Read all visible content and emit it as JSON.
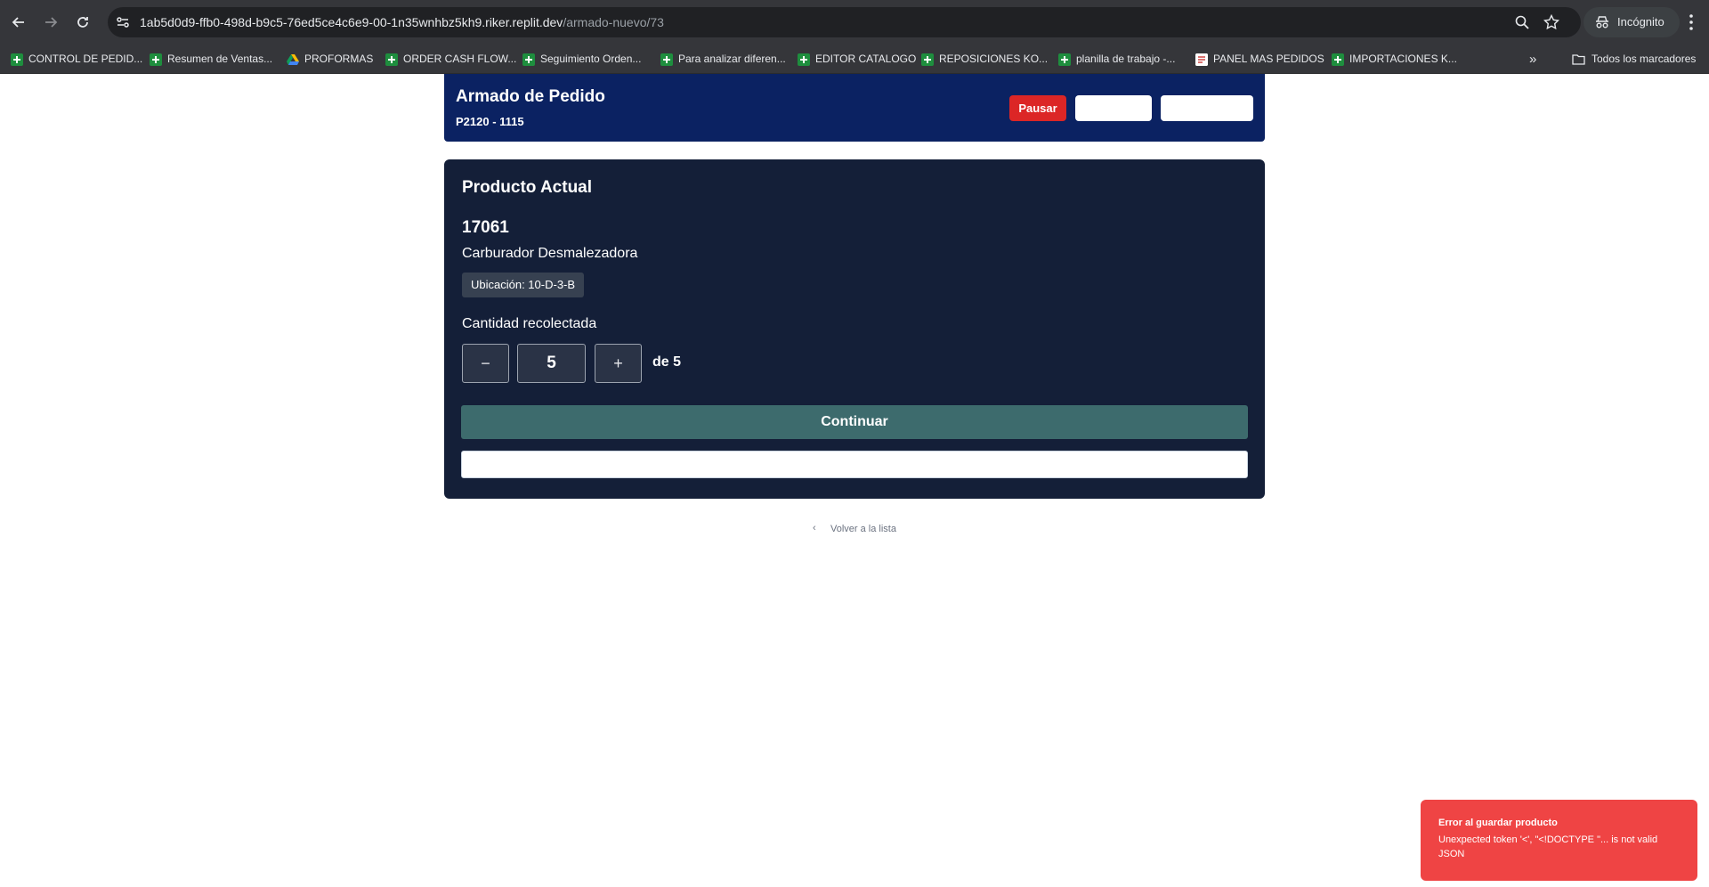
{
  "browser": {
    "url_host": "1ab5d0d9-ffb0-498d-b9c5-76ed5ce4c6e9-00-1n35wnhbz5kh9.riker.replit.dev",
    "url_path": "/armado-nuevo/73",
    "incognito_label": "Incógnito",
    "bookmarks": [
      {
        "label": "CONTROL DE PEDID...",
        "icon": "sheets-icon"
      },
      {
        "label": "Resumen de Ventas...",
        "icon": "sheets-icon"
      },
      {
        "label": "PROFORMAS",
        "icon": "drive-icon"
      },
      {
        "label": "ORDER CASH FLOW...",
        "icon": "sheets-icon"
      },
      {
        "label": "Seguimiento Orden...",
        "icon": "sheets-icon"
      },
      {
        "label": "Para analizar diferen...",
        "icon": "sheets-icon"
      },
      {
        "label": "EDITOR CATALOGO",
        "icon": "sheets-icon"
      },
      {
        "label": "REPOSICIONES KO...",
        "icon": "sheets-icon"
      },
      {
        "label": "planilla de trabajo -...",
        "icon": "sheets-icon"
      },
      {
        "label": "PANEL MAS PEDIDOS",
        "icon": "doc-icon"
      },
      {
        "label": "IMPORTACIONES K...",
        "icon": "sheets-icon"
      }
    ],
    "more_bookmarks": "»",
    "all_bookmarks_label": "Todos los marcadores"
  },
  "header": {
    "title": "Armado de Pedido",
    "subtitle": "P2120 - 1115",
    "pause_label": "Pausar",
    "pause_color": "#dc2626"
  },
  "product": {
    "section_title": "Producto Actual",
    "code": "17061",
    "name": "Carburador Desmalezadora",
    "location": "Ubicación: 10-D-3-B",
    "quantity_label": "Cantidad recolectada",
    "decrement": "−",
    "increment": "+",
    "quantity": "5",
    "of_total": "de 5",
    "continue_label": "Continuar",
    "continue_color": "#3d6b6d"
  },
  "back_link": "Volver a la lista",
  "toast": {
    "title": "Error al guardar producto",
    "message": "Unexpected token '<', \"<!DOCTYPE \"... is not valid JSON",
    "color": "#ef4444"
  }
}
